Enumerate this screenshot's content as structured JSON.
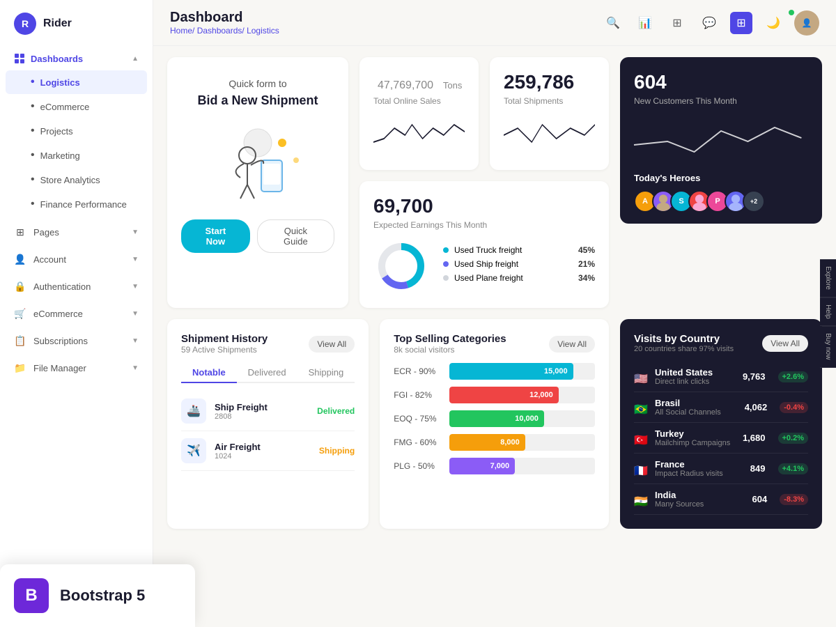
{
  "app": {
    "name": "Rider",
    "logo_letter": "R"
  },
  "sidebar": {
    "dashboards_label": "Dashboards",
    "items": [
      {
        "id": "logistics",
        "label": "Logistics",
        "active": true
      },
      {
        "id": "ecommerce",
        "label": "eCommerce",
        "active": false
      },
      {
        "id": "projects",
        "label": "Projects",
        "active": false
      },
      {
        "id": "marketing",
        "label": "Marketing",
        "active": false
      },
      {
        "id": "store-analytics",
        "label": "Store Analytics",
        "active": false
      },
      {
        "id": "finance-performance",
        "label": "Finance Performance",
        "active": false
      }
    ],
    "pages_label": "Pages",
    "account_label": "Account",
    "authentication_label": "Authentication",
    "ecommerce_label": "eCommerce",
    "subscriptions_label": "Subscriptions",
    "file_manager_label": "File Manager"
  },
  "header": {
    "title": "Dashboard",
    "breadcrumb": [
      "Home",
      "Dashboards",
      "Logistics"
    ]
  },
  "promo": {
    "title": "Quick form to",
    "subtitle": "Bid a New Shipment",
    "btn_primary": "Start Now",
    "btn_outline": "Quick Guide"
  },
  "stats": {
    "total_sales": "47,769,700",
    "total_sales_unit": "Tons",
    "total_sales_label": "Total Online Sales",
    "total_shipments": "259,786",
    "total_shipments_label": "Total Shipments",
    "expected_earnings": "69,700",
    "expected_earnings_label": "Expected Earnings This Month",
    "new_customers": "604",
    "new_customers_label": "New Customers This Month"
  },
  "freight": {
    "used_truck": "Used Truck freight",
    "used_truck_pct": "45%",
    "used_ship": "Used Ship freight",
    "used_ship_pct": "21%",
    "used_plane": "Used Plane freight",
    "used_plane_pct": "34%"
  },
  "heroes": {
    "title": "Today's Heroes",
    "avatars": [
      {
        "color": "#f59e0b",
        "letter": "A"
      },
      {
        "color": "#8b5cf6",
        "letter": ""
      },
      {
        "color": "#06b6d4",
        "letter": "S"
      },
      {
        "color": "#ef4444",
        "letter": ""
      },
      {
        "color": "#ec4899",
        "letter": "P"
      },
      {
        "color": "#6366f1",
        "letter": ""
      },
      {
        "color": "#374151",
        "letter": "+2"
      }
    ]
  },
  "shipment_history": {
    "title": "Shipment History",
    "subtitle": "59 Active Shipments",
    "view_all": "View All",
    "tabs": [
      "Notable",
      "Delivered",
      "Shipping"
    ],
    "items": [
      {
        "name": "Ship Freight",
        "id": "2808",
        "status": "Delivered",
        "status_type": "delivered"
      },
      {
        "name": "Air Freight",
        "id": "1024",
        "status": "Shipping",
        "status_type": "shipping"
      }
    ]
  },
  "top_selling": {
    "title": "Top Selling Categories",
    "subtitle": "8k social visitors",
    "view_all": "View All",
    "bars": [
      {
        "label": "ECR - 90%",
        "value": 15000,
        "display": "15,000",
        "color": "#06b6d4",
        "width": "85%"
      },
      {
        "label": "FGI - 82%",
        "value": 12000,
        "display": "12,000",
        "color": "#ef4444",
        "width": "75%"
      },
      {
        "label": "EOQ - 75%",
        "value": 10000,
        "display": "10,000",
        "color": "#22c55e",
        "width": "65%"
      },
      {
        "label": "FMG - 60%",
        "value": 8000,
        "display": "8,000",
        "color": "#f59e0b",
        "width": "52%"
      },
      {
        "label": "PLG - 50%",
        "value": 7000,
        "display": "7,000",
        "color": "#8b5cf6",
        "width": "45%"
      }
    ]
  },
  "visits_by_country": {
    "title": "Visits by Country",
    "subtitle": "20 countries share 97% visits",
    "view_all": "View All",
    "countries": [
      {
        "name": "United States",
        "source": "Direct link clicks",
        "visits": "9,763",
        "change": "+2.6%",
        "trend": "up",
        "flag": "🇺🇸"
      },
      {
        "name": "Brasil",
        "source": "All Social Channels",
        "visits": "4,062",
        "change": "-0.4%",
        "trend": "down",
        "flag": "🇧🇷"
      },
      {
        "name": "Turkey",
        "source": "Mailchimp Campaigns",
        "visits": "1,680",
        "change": "+0.2%",
        "trend": "up",
        "flag": "🇹🇷"
      },
      {
        "name": "France",
        "source": "Impact Radius visits",
        "visits": "849",
        "change": "+4.1%",
        "trend": "up",
        "flag": "🇫🇷"
      },
      {
        "name": "India",
        "source": "Many Sources",
        "visits": "604",
        "change": "-8.3%",
        "trend": "down",
        "flag": "🇮🇳"
      }
    ]
  },
  "side_tabs": [
    "Explore",
    "Help",
    "Buy now"
  ],
  "bootstrap_overlay": {
    "letter": "B",
    "text": "Bootstrap 5"
  }
}
